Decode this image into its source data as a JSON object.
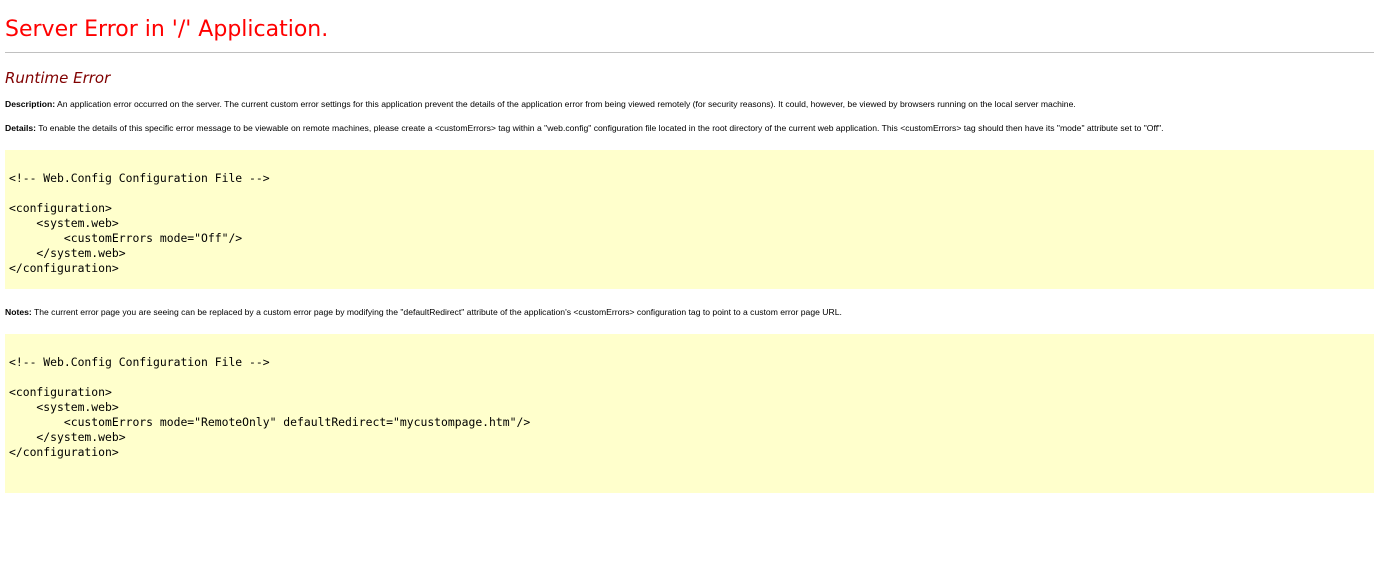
{
  "header": {
    "title": "Server Error in '/' Application.",
    "subtitle": "Runtime Error"
  },
  "description": {
    "label": "Description:",
    "text": " An application error occurred on the server. The current custom error settings for this application prevent the details of the application error from being viewed remotely (for security reasons). It could, however, be viewed by browsers running on the local server machine."
  },
  "details": {
    "label": "Details:",
    "text": " To enable the details of this specific error message to be viewable on remote machines, please create a <customErrors> tag within a \"web.config\" configuration file located in the root directory of the current web application. This <customErrors> tag should then have its \"mode\" attribute set to \"Off\"."
  },
  "code1": {
    "comment": "<!-- Web.Config Configuration File -->",
    "lines": [
      "<configuration>",
      "    <system.web>",
      "        <customErrors mode=\"Off\"/>",
      "    </system.web>",
      "</configuration>"
    ]
  },
  "notes": {
    "label": "Notes:",
    "text": " The current error page you are seeing can be replaced by a custom error page by modifying the \"defaultRedirect\" attribute of the application's <customErrors> configuration tag to point to a custom error page URL."
  },
  "code2": {
    "comment": "<!-- Web.Config Configuration File -->",
    "lines": [
      "<configuration>",
      "    <system.web>",
      "        <customErrors mode=\"RemoteOnly\" defaultRedirect=\"mycustompage.htm\"/>",
      "    </system.web>",
      "</configuration>"
    ]
  },
  "colors": {
    "title": "#ff0000",
    "subtitle": "#800000",
    "code_background": "#ffffcc",
    "rule": "#c0c0c0"
  }
}
